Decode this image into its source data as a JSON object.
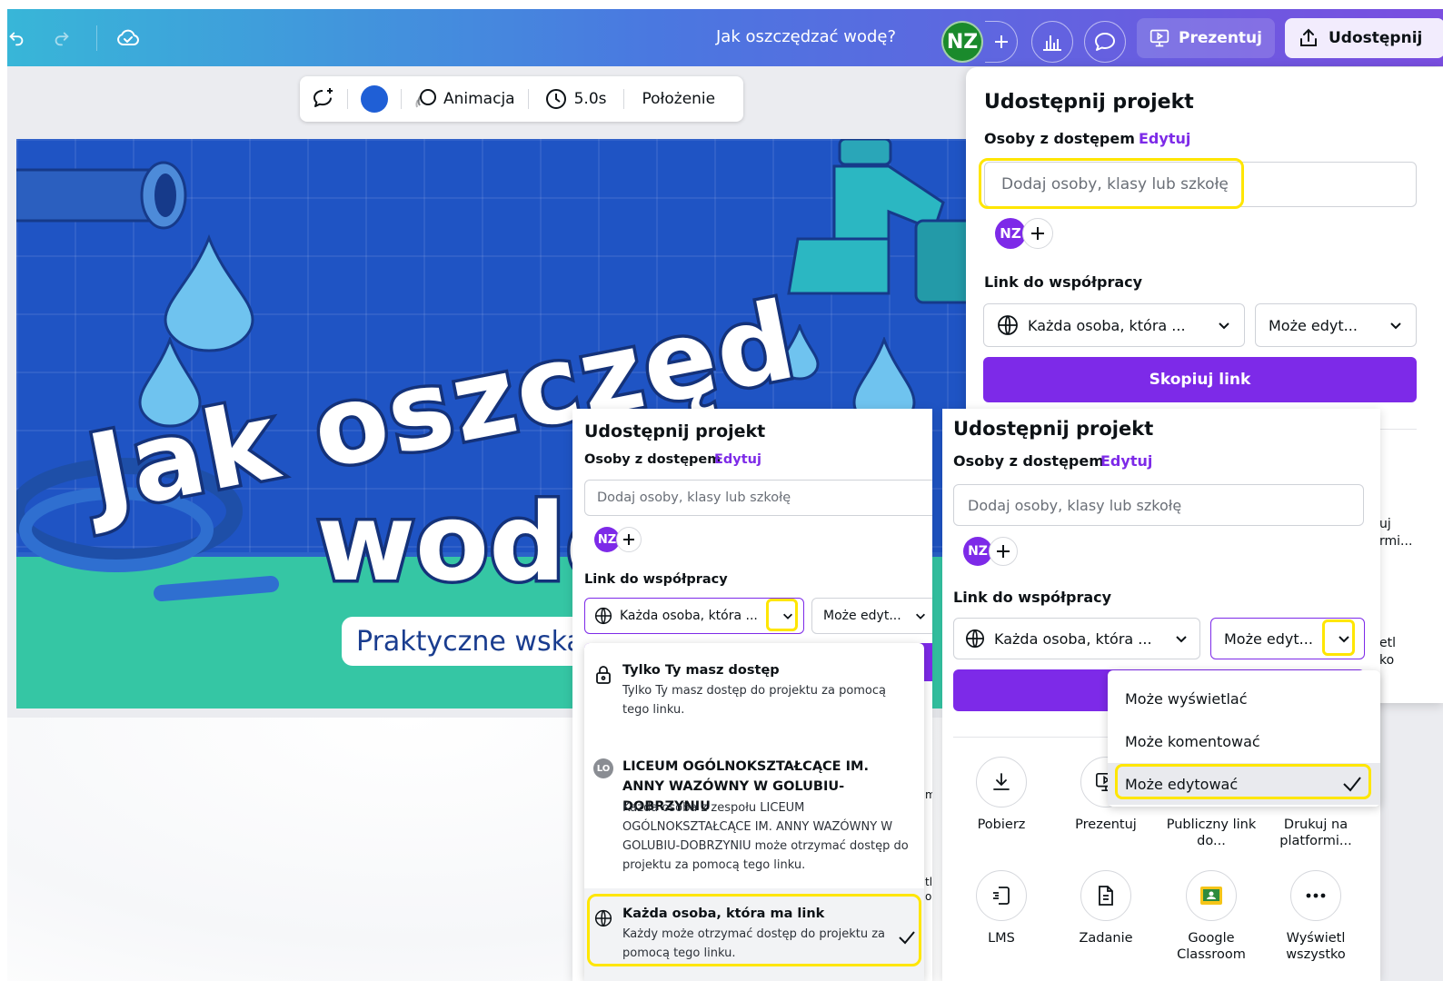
{
  "topbar": {
    "doc_title": "Jak oszczędzać wodę?",
    "avatar_initials": "NZ",
    "present_label": "Prezentuj",
    "share_label": "Udostępnij"
  },
  "element_toolbar": {
    "animation_label": "Animacja",
    "duration_label": "5.0s",
    "position_label": "Położenie",
    "color": "#1f5fd6"
  },
  "slide": {
    "title_line1": "Jak oszczęd",
    "title_line2": "wodę",
    "subtitle": "Praktyczne wskazówki"
  },
  "panel_main": {
    "title": "Udostępnij projekt",
    "people_label": "Osoby z dostępem",
    "edit_link": "Edytuj",
    "input_placeholder": "Dodaj osoby, klasy lub szkołę",
    "avatar": "NZ",
    "collab_label": "Link do współpracy",
    "access_value": "Każda osoba, która ...",
    "permission_value": "Może edyt...",
    "copy_button": "Skopiuj link",
    "peek_labels": [
      "uj",
      "rmi...",
      "etl",
      "ko"
    ]
  },
  "panel_left": {
    "title": "Udostępnij projekt",
    "people_label": "Osoby z dostępem",
    "edit_link": "Edytuj",
    "input_placeholder": "Dodaj osoby, klasy lub szkołę",
    "avatar": "NZ",
    "collab_label": "Link do współpracy",
    "access_value": "Każda osoba, która ...",
    "permission_value": "Może edyt...",
    "menu": {
      "only_you_title": "Tylko Ty masz dostęp",
      "only_you_desc": "Tylko Ty masz dostęp do projektu za pomocą tego linku.",
      "school_badge": "LO",
      "school_title": "LICEUM OGÓLNOKSZTAŁCĄCE IM. ANNY WAZÓWNY W GOLUBIU-DOBRZYNIU",
      "school_desc": "Każda osoba z zespołu LICEUM OGÓLNOKSZTAŁCĄCE IM. ANNY WAZÓWNY W GOLUBIU-DOBRZYNIU może otrzymać dostęp do projektu za pomocą tego linku.",
      "anyone_title": "Każda osoba, która ma link",
      "anyone_desc": "Każdy może otrzymać dostęp do projektu za pomocą tego linku."
    },
    "peek_labels": [
      "m",
      "tl",
      "o"
    ]
  },
  "panel_right": {
    "title": "Udostępnij projekt",
    "people_label": "Osoby z dostępem",
    "edit_link": "Edytuj",
    "input_placeholder": "Dodaj osoby, klasy lub szkołę",
    "avatar": "NZ",
    "collab_label": "Link do współpracy",
    "access_value": "Każda osoba, która ...",
    "permission_value": "Może edyt...",
    "permission_menu": [
      "Może wyświetlać",
      "Może komentować",
      "Może edytować"
    ],
    "share_options": [
      {
        "label": "Pobierz",
        "icon": "download-icon"
      },
      {
        "label": "Prezentuj",
        "icon": "present-icon"
      },
      {
        "label": "Publiczny link do...",
        "icon": "public-link-icon"
      },
      {
        "label": "Drukuj na platformi...",
        "icon": "print-icon"
      },
      {
        "label": "LMS",
        "icon": "lms-icon"
      },
      {
        "label": "Zadanie",
        "icon": "assignment-icon"
      },
      {
        "label": "Google Classroom",
        "icon": "google-classroom-icon"
      },
      {
        "label": "Wyświetl wszystko",
        "icon": "more-icon"
      }
    ]
  },
  "colors": {
    "accent": "#7d2ae8",
    "highlight": "#ffe600",
    "avatar_green": "#1a8a2c"
  }
}
